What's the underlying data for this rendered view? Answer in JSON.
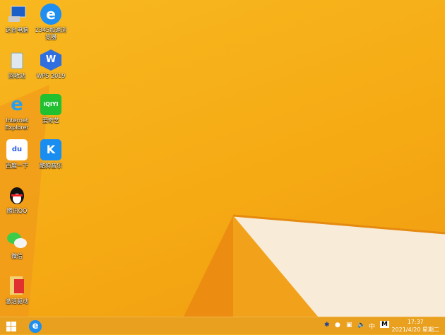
{
  "desktop": {
    "icons": [
      {
        "label": "这台电脑",
        "icon": "computer-icon"
      },
      {
        "label": "2345加速浏览器",
        "icon": "browser-2345-icon"
      },
      {
        "label": "回收站",
        "icon": "recycle-bin-icon"
      },
      {
        "label": "WPS 2019",
        "icon": "wps-icon"
      },
      {
        "label": "Internet Explorer",
        "icon": "ie-icon"
      },
      {
        "label": "爱奇艺",
        "icon": "iqiyi-icon",
        "glyph": "iQIYI"
      },
      {
        "label": "百度一下",
        "icon": "baidu-icon",
        "glyph": "du"
      },
      {
        "label": "酷狗音乐",
        "icon": "kugou-icon",
        "glyph": "K"
      },
      {
        "label": "腾讯QQ",
        "icon": "qq-icon"
      },
      {
        "label": "微信",
        "icon": "wechat-icon"
      },
      {
        "label": "激活驱动",
        "icon": "folder-icon"
      }
    ]
  },
  "taskbar": {
    "tray": {
      "ime": "中",
      "ime_mode": "M"
    },
    "clock": {
      "time": "17:37",
      "date": "2021/4/20 星期二"
    }
  },
  "colors": {
    "wallpaper": "#f6b01c",
    "taskbar": "#e9a01e"
  }
}
